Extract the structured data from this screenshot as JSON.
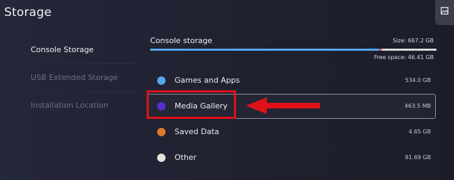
{
  "page": {
    "title": "Storage"
  },
  "sidebar": {
    "items": [
      {
        "label": "Console Storage",
        "active": true
      },
      {
        "label": "USB Extended Storage",
        "active": false
      },
      {
        "label": "Installation Location",
        "active": false
      }
    ]
  },
  "storage": {
    "label": "Console storage",
    "size_text": "Size: 667.2 GB",
    "free_text": "Free space: 46.41 GB",
    "bar_segments": [
      {
        "fraction": 0.7998,
        "color": "#56a8ee"
      },
      {
        "fraction": 0.0007,
        "color": "#5b2ccf"
      },
      {
        "fraction": 0.007,
        "color": "#e07b2b"
      },
      {
        "fraction": 0.1224,
        "color": "#d9d9dd"
      }
    ]
  },
  "categories": [
    {
      "name": "Games and Apps",
      "size": "534.0 GB",
      "color": "#56a8ee",
      "selected": false
    },
    {
      "name": "Media Gallery",
      "size": "463.5 MB",
      "color": "#5b2ccf",
      "selected": true
    },
    {
      "name": "Saved Data",
      "size": "4.65 GB",
      "color": "#e07b2b",
      "selected": false
    },
    {
      "name": "Other",
      "size": "81.69 GB",
      "color": "#e4e1da",
      "selected": false
    }
  ],
  "icons": {
    "corner": "image-icon",
    "annotation": "red-arrow-icon"
  },
  "colors": {
    "highlight": "#e01218",
    "background": "#212330"
  }
}
